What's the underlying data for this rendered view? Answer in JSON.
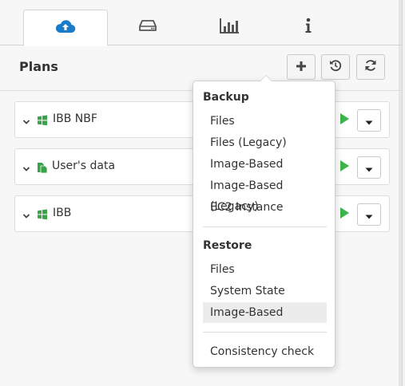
{
  "tabs": [
    {
      "icon": "cloud-upload-icon",
      "active": true
    },
    {
      "icon": "hard-drive-icon",
      "active": false
    },
    {
      "icon": "bar-chart-icon",
      "active": false
    },
    {
      "icon": "info-icon",
      "active": false
    }
  ],
  "header": {
    "title": "Plans",
    "buttons": [
      {
        "icon": "plus-icon"
      },
      {
        "icon": "history-icon"
      },
      {
        "icon": "refresh-icon"
      }
    ]
  },
  "plans": [
    {
      "name": "IBB NBF",
      "icon": "windows-icon"
    },
    {
      "name": "User's data",
      "icon": "files-icon"
    },
    {
      "name": "IBB",
      "icon": "windows-icon"
    }
  ],
  "menu": {
    "backup_header": "Backup",
    "backup_items": [
      "Files",
      "Files (Legacy)",
      "Image-Based",
      "Image-Based (Legacy)",
      "EC2 Instance"
    ],
    "restore_header": "Restore",
    "restore_items": [
      "Files",
      "System State",
      "Image-Based"
    ],
    "other_items": [
      "Consistency check"
    ]
  },
  "colors": {
    "accent": "#1a7bc9",
    "green": "#3cb44a",
    "plan_icon_green": "#3aa34a"
  }
}
